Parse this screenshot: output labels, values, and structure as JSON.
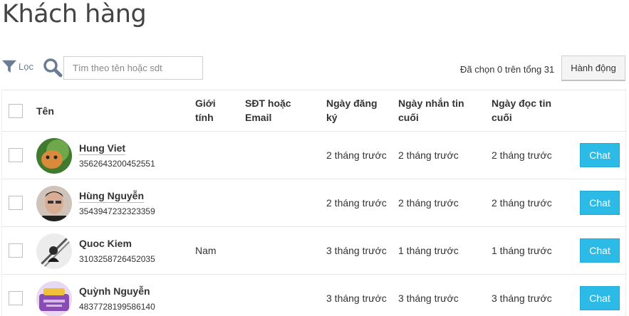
{
  "page": {
    "title": "Khách hàng"
  },
  "toolbar": {
    "filter_label": "Lọc",
    "search_placeholder": "Tìm theo tên hoặc sdt",
    "search_value": "",
    "selection_text": "Đã chọn 0 trên tổng 31",
    "action_label": "Hành động"
  },
  "table": {
    "headers": {
      "name": "Tên",
      "gender": "Giới\ntính",
      "contact": "SĐT hoặc\nEmail",
      "registered": "Ngày đăng\nký",
      "last_message": "Ngày nhắn tin\ncuối",
      "last_read": "Ngày đọc tin\ncuối"
    },
    "rows": [
      {
        "name": "Hung Viet",
        "phone": "3562643200452551",
        "gender": "",
        "contact": "",
        "registered": "2 tháng trước",
        "last_message": "2 tháng trước",
        "last_read": "2 tháng trước",
        "chat": "Chat",
        "avatar_color": "#4d8a3a"
      },
      {
        "name": "Hùng Nguyễn",
        "phone": "3543947232323359",
        "gender": "",
        "contact": "",
        "registered": "2 tháng trước",
        "last_message": "2 tháng trước",
        "last_read": "2 tháng trước",
        "chat": "Chat",
        "avatar_color": "#c9a897"
      },
      {
        "name": "Quoc Kiem",
        "phone": "3103258726452035",
        "gender": "Nam",
        "contact": "",
        "registered": "3 tháng trước",
        "last_message": "1 tháng trước",
        "last_read": "1 tháng trước",
        "chat": "Chat",
        "avatar_color": "#e8e8e8"
      },
      {
        "name": "Quỳnh Nguyễn",
        "phone": "4837728199586140",
        "gender": "",
        "contact": "",
        "registered": "3 tháng trước",
        "last_message": "3 tháng trước",
        "last_read": "3 tháng trước",
        "chat": "Chat",
        "avatar_color": "#8a4bb5"
      }
    ]
  },
  "colors": {
    "accent": "#2bbbe6",
    "filter_icon": "#6a7d95"
  }
}
